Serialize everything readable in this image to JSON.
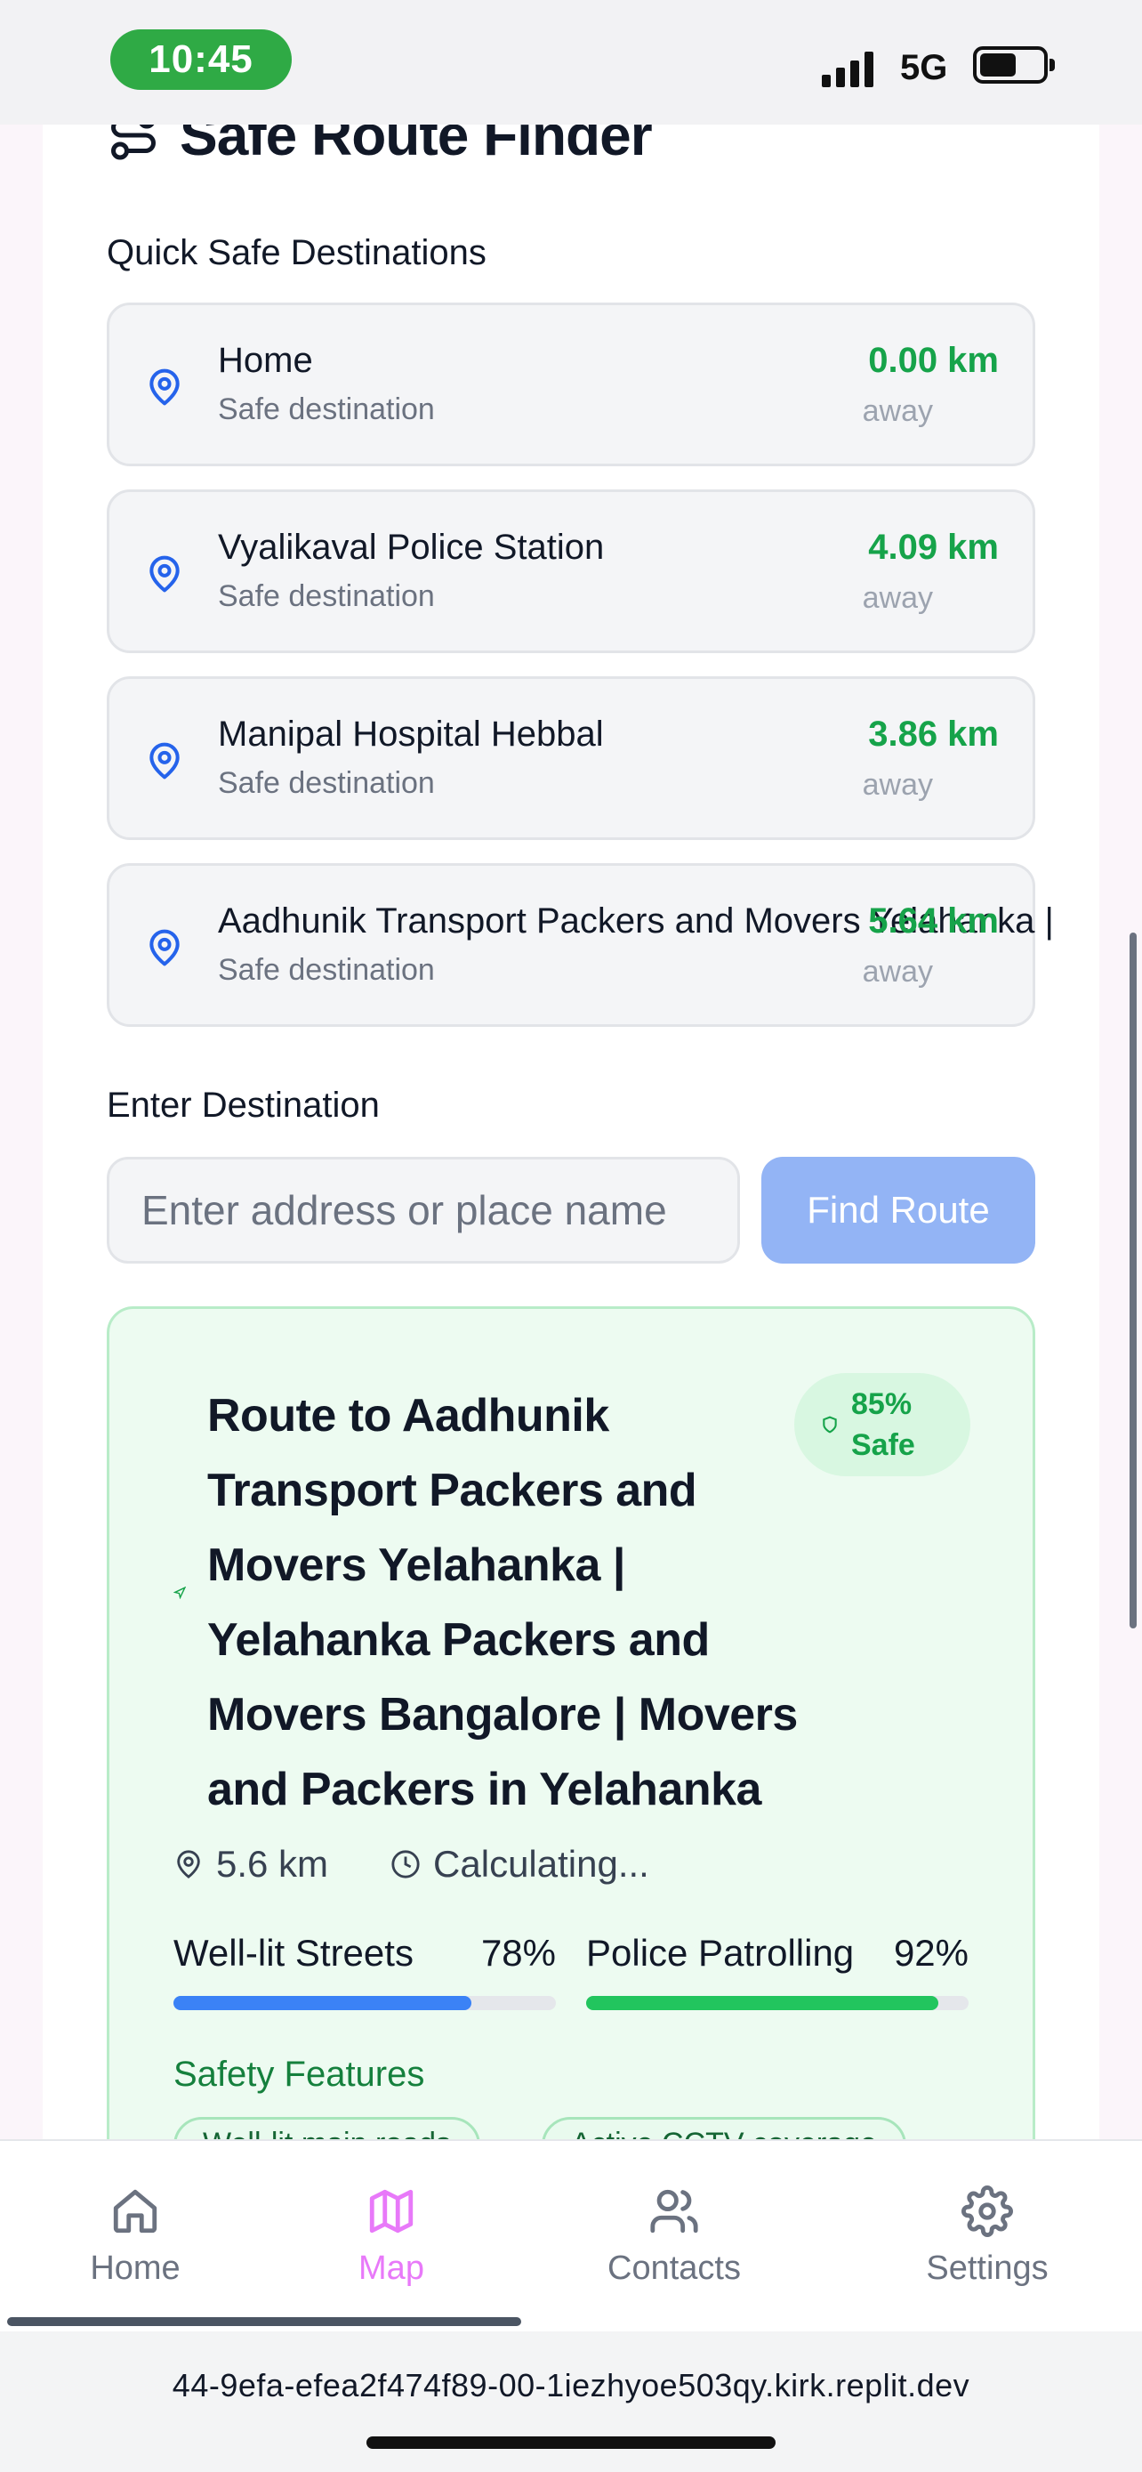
{
  "status_bar": {
    "time": "10:45",
    "network": "5G"
  },
  "header": {
    "title": "Safe Route Finder"
  },
  "quick_destinations": {
    "label": "Quick Safe Destinations",
    "items": [
      {
        "name": "Home",
        "subtitle": "Safe destination",
        "distance": "0.00 km",
        "away": "away"
      },
      {
        "name": "Vyalikaval Police Station",
        "subtitle": "Safe destination",
        "distance": "4.09 km",
        "away": "away"
      },
      {
        "name": "Manipal Hospital Hebbal",
        "subtitle": "Safe destination",
        "distance": "3.86 km",
        "away": "away"
      },
      {
        "name": "Aadhunik Transport Packers and Movers Yelahanka |",
        "subtitle": "Safe destination",
        "distance": "5.64 km",
        "away": "away"
      }
    ]
  },
  "destination": {
    "label": "Enter Destination",
    "placeholder": "Enter address or place name",
    "button": "Find Route"
  },
  "route": {
    "title": "Route to Aadhunik Transport Packers and Movers Yelahanka | Yelahanka Packers and Movers Bangalore | Movers and Packers in Yelahanka",
    "safety_score": "85%",
    "safety_word": "Safe",
    "distance": "5.6 km",
    "duration": "Calculating...",
    "stats": [
      {
        "label": "Well-lit Streets",
        "percent": "78%",
        "value": 0.78,
        "color": "#3b82f6"
      },
      {
        "label": "Police Patrolling",
        "percent": "92%",
        "value": 0.92,
        "color": "#22c55e"
      }
    ],
    "features_label": "Safety Features",
    "features": [
      "Well-lit main roads",
      "Active CCTV coverage"
    ]
  },
  "tabs": [
    {
      "label": "Home",
      "icon": "home-icon",
      "active": false
    },
    {
      "label": "Map",
      "icon": "map-icon",
      "active": true
    },
    {
      "label": "Contacts",
      "icon": "users-icon",
      "active": false
    },
    {
      "label": "Settings",
      "icon": "gear-icon",
      "active": false
    }
  ],
  "url": "44-9efa-efea2f474f89-00-1iezhyoe503qy.kirk.replit.dev"
}
